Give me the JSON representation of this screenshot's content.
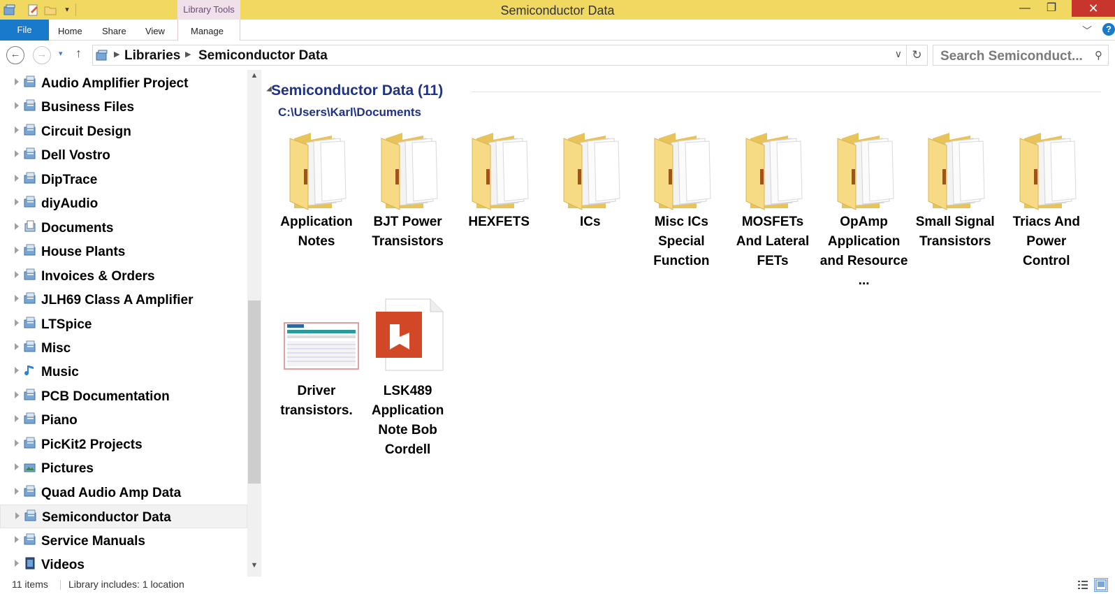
{
  "window": {
    "title": "Semiconductor Data",
    "context_tab_group": "Library Tools",
    "minimize_symbol": "—",
    "maximize_symbol": "❐",
    "close_symbol": "✕"
  },
  "ribbon": {
    "file_tab": "File",
    "tabs": [
      "Home",
      "Share",
      "View",
      "Manage"
    ],
    "help_symbol": "?"
  },
  "address": {
    "breadcrumbs": [
      "Libraries",
      "Semiconductor Data"
    ],
    "search_placeholder": "Search Semiconduct..."
  },
  "sidebar": {
    "items": [
      {
        "label": "Audio Amplifier Project",
        "icon": "library-icon",
        "selected": false
      },
      {
        "label": "Business Files",
        "icon": "library-icon",
        "selected": false
      },
      {
        "label": "Circuit Design",
        "icon": "library-icon",
        "selected": false
      },
      {
        "label": "Dell Vostro",
        "icon": "library-icon",
        "selected": false
      },
      {
        "label": "DipTrace",
        "icon": "library-icon",
        "selected": false
      },
      {
        "label": "diyAudio",
        "icon": "library-icon",
        "selected": false
      },
      {
        "label": "Documents",
        "icon": "documents-library-icon",
        "selected": false
      },
      {
        "label": "House Plants",
        "icon": "library-icon",
        "selected": false
      },
      {
        "label": "Invoices & Orders",
        "icon": "library-icon",
        "selected": false
      },
      {
        "label": "JLH69 Class A Amplifier",
        "icon": "library-icon",
        "selected": false
      },
      {
        "label": "LTSpice",
        "icon": "library-icon",
        "selected": false
      },
      {
        "label": "Misc",
        "icon": "library-icon",
        "selected": false
      },
      {
        "label": "Music",
        "icon": "music-library-icon",
        "selected": false
      },
      {
        "label": "PCB Documentation",
        "icon": "library-icon",
        "selected": false
      },
      {
        "label": "Piano",
        "icon": "library-icon",
        "selected": false
      },
      {
        "label": "PicKit2 Projects",
        "icon": "library-icon",
        "selected": false
      },
      {
        "label": "Pictures",
        "icon": "pictures-library-icon",
        "selected": false
      },
      {
        "label": "Quad Audio Amp Data",
        "icon": "library-icon",
        "selected": false
      },
      {
        "label": "Semiconductor Data",
        "icon": "library-icon",
        "selected": true
      },
      {
        "label": "Service Manuals",
        "icon": "library-icon",
        "selected": false
      },
      {
        "label": "Videos",
        "icon": "videos-library-icon",
        "selected": false
      }
    ]
  },
  "content": {
    "group_title": "Semiconductor Data (11)",
    "group_path": "C:\\Users\\Karl\\Documents",
    "items": [
      {
        "name": "Application Notes",
        "type": "folder"
      },
      {
        "name": "BJT Power Transistors",
        "type": "folder"
      },
      {
        "name": "HEXFETS",
        "type": "folder"
      },
      {
        "name": "ICs",
        "type": "folder"
      },
      {
        "name": "Misc ICs Special Function",
        "type": "folder"
      },
      {
        "name": "MOSFETs And Lateral FETs",
        "type": "folder"
      },
      {
        "name": "OpAmp Application and Resource ...",
        "type": "folder"
      },
      {
        "name": "Small Signal Transistors",
        "type": "folder"
      },
      {
        "name": "Triacs And Power Control",
        "type": "folder"
      },
      {
        "name": "Driver transistors.",
        "type": "spreadsheet-thumbnail"
      },
      {
        "name": "LSK489 Application Note Bob Cordell",
        "type": "pdf-document"
      }
    ]
  },
  "status": {
    "item_count": "11 items",
    "library_info": "Library includes: 1 location"
  },
  "colors": {
    "titlebar": "#f1d861",
    "file_tab": "#1979ca",
    "group_heading": "#1e3287",
    "close_button": "#c7352c",
    "pdf_red": "#d24726"
  }
}
